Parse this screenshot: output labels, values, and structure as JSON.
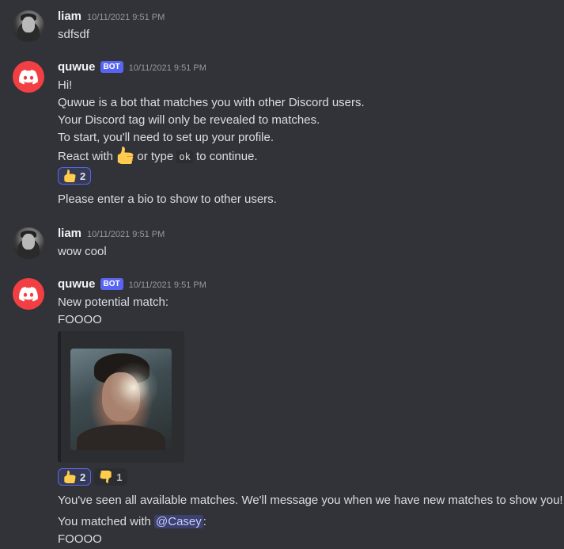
{
  "messages": [
    {
      "author": "liam",
      "timestamp": "10/11/2021 9:51 PM",
      "lines": [
        "sdfsdf"
      ]
    },
    {
      "author": "quwue",
      "bot_tag": "BOT",
      "timestamp": "10/11/2021 9:51 PM",
      "lines": [
        "Hi!",
        "Quwue is a bot that matches you with other Discord users.",
        "Your Discord tag will only be revealed to matches.",
        "To start, you'll need to set up your profile."
      ],
      "react_line": {
        "before": "React with",
        "emoji": "thumbs-up",
        "middle": "or type",
        "code": "ok",
        "after": "to continue."
      },
      "reactions": [
        {
          "emoji": "thumbs-up",
          "count": "2",
          "me": true
        }
      ],
      "followup": "Please enter a bio to show to other users."
    },
    {
      "author": "liam",
      "timestamp": "10/11/2021 9:51 PM",
      "lines": [
        "wow cool"
      ]
    },
    {
      "author": "quwue",
      "bot_tag": "BOT",
      "timestamp": "10/11/2021 9:51 PM",
      "lines": [
        "New potential match:",
        "FOOOO"
      ],
      "reactions": [
        {
          "emoji": "thumbs-up",
          "count": "2",
          "me": true
        },
        {
          "emoji": "thumbs-down",
          "count": "1",
          "me": false
        }
      ],
      "followup": "You've seen all available matches. We'll message you when we have new matches to show you!",
      "match_line": {
        "before": "You matched with",
        "mention": "@Casey",
        "after": ":"
      },
      "final_line": "FOOOO"
    }
  ],
  "colors": {
    "background": "#313338",
    "bot_avatar": "#f23f43",
    "bot_tag": "#5865f2",
    "emoji_yellow": "#ffcc4d"
  }
}
